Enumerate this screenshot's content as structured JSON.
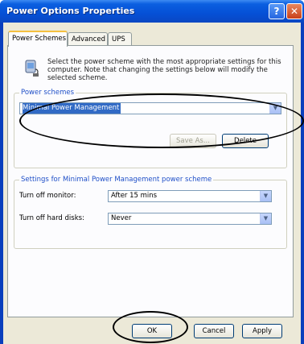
{
  "window": {
    "title": "Power Options Properties",
    "help_glyph": "?",
    "close_glyph": "✕"
  },
  "tabs": [
    {
      "label": "Power Schemes",
      "active": true
    },
    {
      "label": "Advanced",
      "active": false
    },
    {
      "label": "UPS",
      "active": false
    }
  ],
  "intro_text": "Select the power scheme with the most appropriate settings for this computer. Note that changing the settings below will modify the selected scheme.",
  "power_schemes": {
    "group_label": "Power schemes",
    "selected": "Minimal Power Management",
    "save_as_label": "Save As...",
    "delete_label": "Delete"
  },
  "settings": {
    "group_label": "Settings for Minimal Power Management power scheme",
    "rows": [
      {
        "label": "Turn off monitor:",
        "value": "After 15 mins"
      },
      {
        "label": "Turn off hard disks:",
        "value": "Never"
      }
    ]
  },
  "buttons": {
    "ok": "OK",
    "cancel": "Cancel",
    "apply": "Apply"
  },
  "colors": {
    "titlebar": "#0550d6",
    "dialog_face": "#ece9d8",
    "selection": "#316ac5",
    "group_label": "#2050c8"
  },
  "icons": {
    "scheme_icon": "power-plug-icon",
    "dropdown": "chevron-down-icon"
  }
}
